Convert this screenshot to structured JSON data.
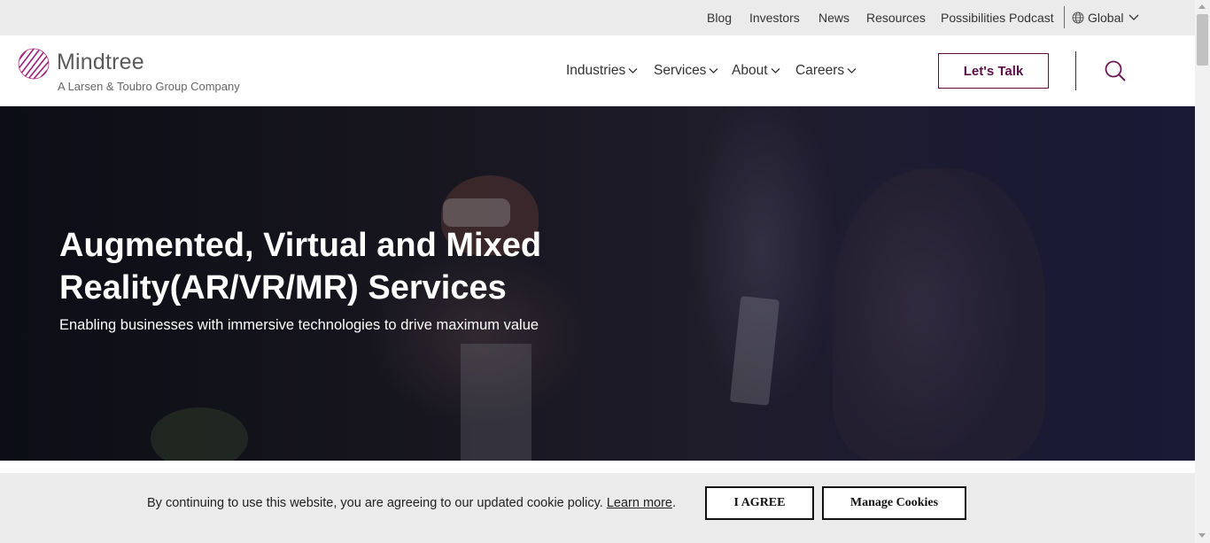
{
  "utility_nav": {
    "links": [
      "Blog",
      "Investors",
      "News",
      "Resources",
      "Possibilities Podcast"
    ],
    "region": "Global"
  },
  "brand": {
    "name": "Mindtree",
    "tagline": "A Larsen & Toubro Group Company",
    "color": "#5a0f45"
  },
  "main_nav": {
    "items": [
      "Industries",
      "Services",
      "About",
      "Careers"
    ],
    "cta": "Let's Talk"
  },
  "hero": {
    "title": "Augmented, Virtual and Mixed Reality(AR/VR/MR) Services",
    "subtitle": "Enabling businesses with immersive technologies to drive maximum value"
  },
  "cookie_banner": {
    "text": "By continuing to use this website, you are agreeing to our updated cookie policy.",
    "link": "Learn more",
    "trailing": ".",
    "agree_label": "I AGREE",
    "manage_label": "Manage Cookies"
  },
  "icons": [
    "globe-icon",
    "chevron-down-icon",
    "search-icon",
    "mindtree-logo-icon"
  ]
}
